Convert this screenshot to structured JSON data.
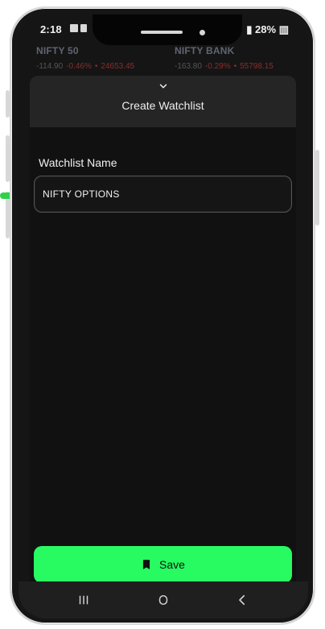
{
  "status": {
    "time": "2:18",
    "battery": "28%"
  },
  "market": [
    {
      "name": "NIFTY 50",
      "change": "-114.90",
      "percent": "-0.46%",
      "value": "24653.45"
    },
    {
      "name": "NIFTY BANK",
      "change": "-163.80",
      "percent": "-0.29%",
      "value": "55798.15"
    }
  ],
  "sheet": {
    "title": "Create Watchlist",
    "field_label": "Watchlist Name",
    "input_value": "NIFTY OPTIONS",
    "save_label": "Save"
  },
  "colors": {
    "background": "#151515",
    "accent": "#28fb62",
    "negative": "#8c2c2c"
  },
  "icons": {
    "status_one": "image-icon",
    "status_two": "message-icon",
    "sheet_toggle": "chevron-down-icon",
    "save": "bookmark-icon",
    "recent_apps": "recent-apps-icon",
    "home": "home-icon",
    "back": "back-icon"
  }
}
